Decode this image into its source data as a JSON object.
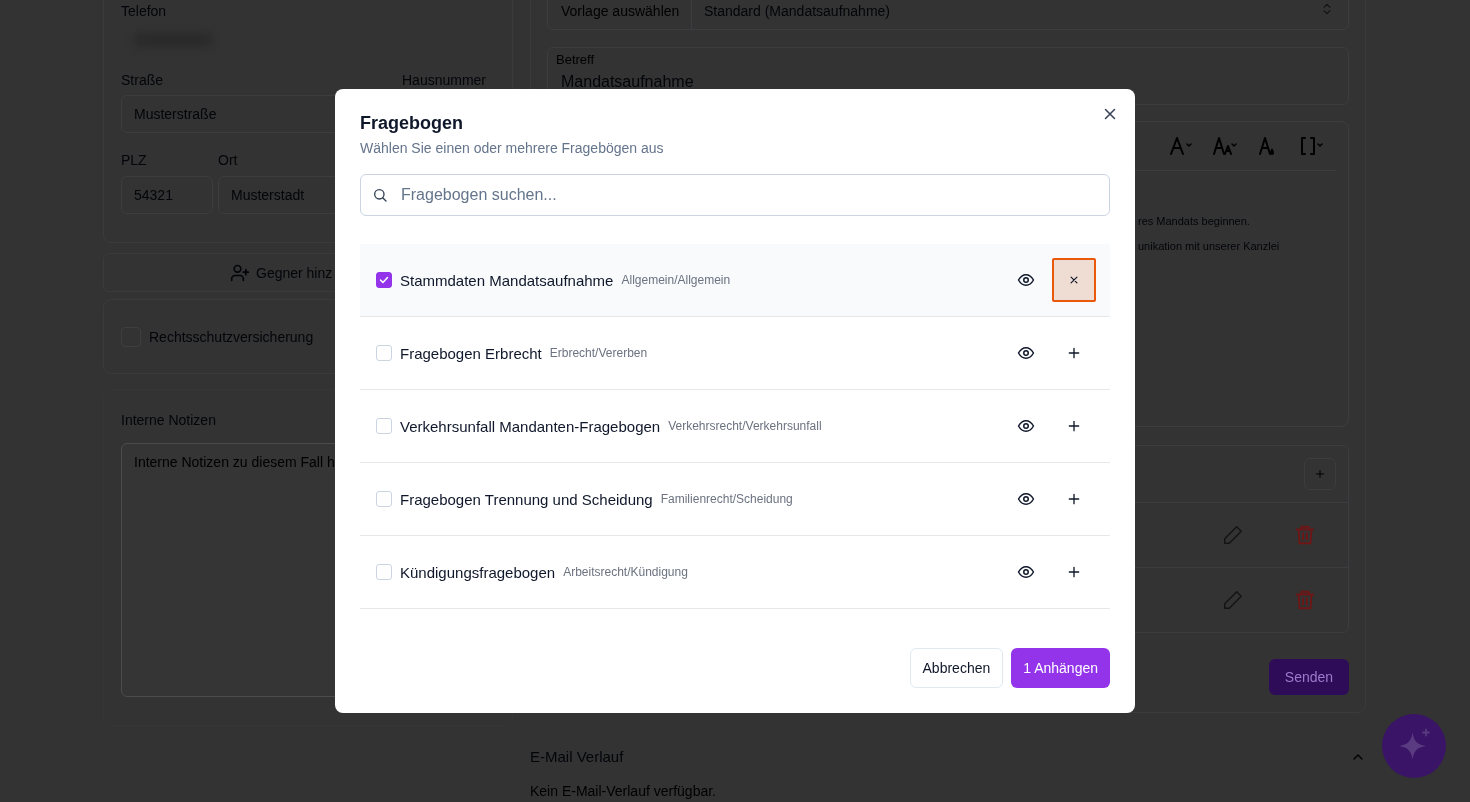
{
  "background": {
    "client_form": {
      "phone_label": "Telefon",
      "street_label": "Straße",
      "house_number_label": "Hausnummer",
      "street_value": "Musterstraße",
      "zip_label": "PLZ",
      "city_label": "Ort",
      "zip_value": "54321",
      "city_value": "Musterstadt"
    },
    "add_opponent_button": "Gegner hinz",
    "legal_insurance": {
      "label": "Rechtsschutzversicherung",
      "checked": false
    },
    "notes": {
      "label": "Interne Notizen",
      "placeholder": "Interne Notizen zu diesem Fall h"
    },
    "email_form": {
      "template_label": "Vorlage auswählen",
      "template_value": "Standard (Mandatsaufnahme)",
      "subject_label": "Betreff",
      "subject_value": "Mandatsaufnahme",
      "body_lines": [
        "res Mandats beginnen.",
        "unikation mit unserer Kanzlei"
      ],
      "send_button": "Senden"
    },
    "history": {
      "title": "E-Mail Verlauf",
      "expanded": true,
      "empty_text": "Kein E-Mail-Verlauf verfügbar."
    }
  },
  "dialog": {
    "title": "Fragebogen",
    "subtitle": "Wählen Sie einen oder mehrere Fragebögen aus",
    "search": {
      "placeholder": "Fragebogen suchen..."
    },
    "items": [
      {
        "name": "Stammdaten Mandatsaufnahme",
        "category": "Allgemein/Allgemein",
        "checked": true,
        "focused": true
      },
      {
        "name": "Fragebogen Erbrecht",
        "category": "Erbrecht/Vererben",
        "checked": false,
        "focused": false
      },
      {
        "name": "Verkehrsunfall Mandanten-Fragebogen",
        "category": "Verkehrsrecht/Verkehrsunfall",
        "checked": false,
        "focused": false
      },
      {
        "name": "Fragebogen Trennung und Scheidung",
        "category": "Familienrecht/Scheidung",
        "checked": false,
        "focused": false
      },
      {
        "name": "Kündigungsfragebogen",
        "category": "Arbeitsrecht/Kündigung",
        "checked": false,
        "focused": false
      }
    ],
    "buttons": [
      {
        "label": "Abbrechen",
        "kind": "secondary"
      },
      {
        "label": "1 Anhängen",
        "kind": "primary"
      }
    ]
  }
}
